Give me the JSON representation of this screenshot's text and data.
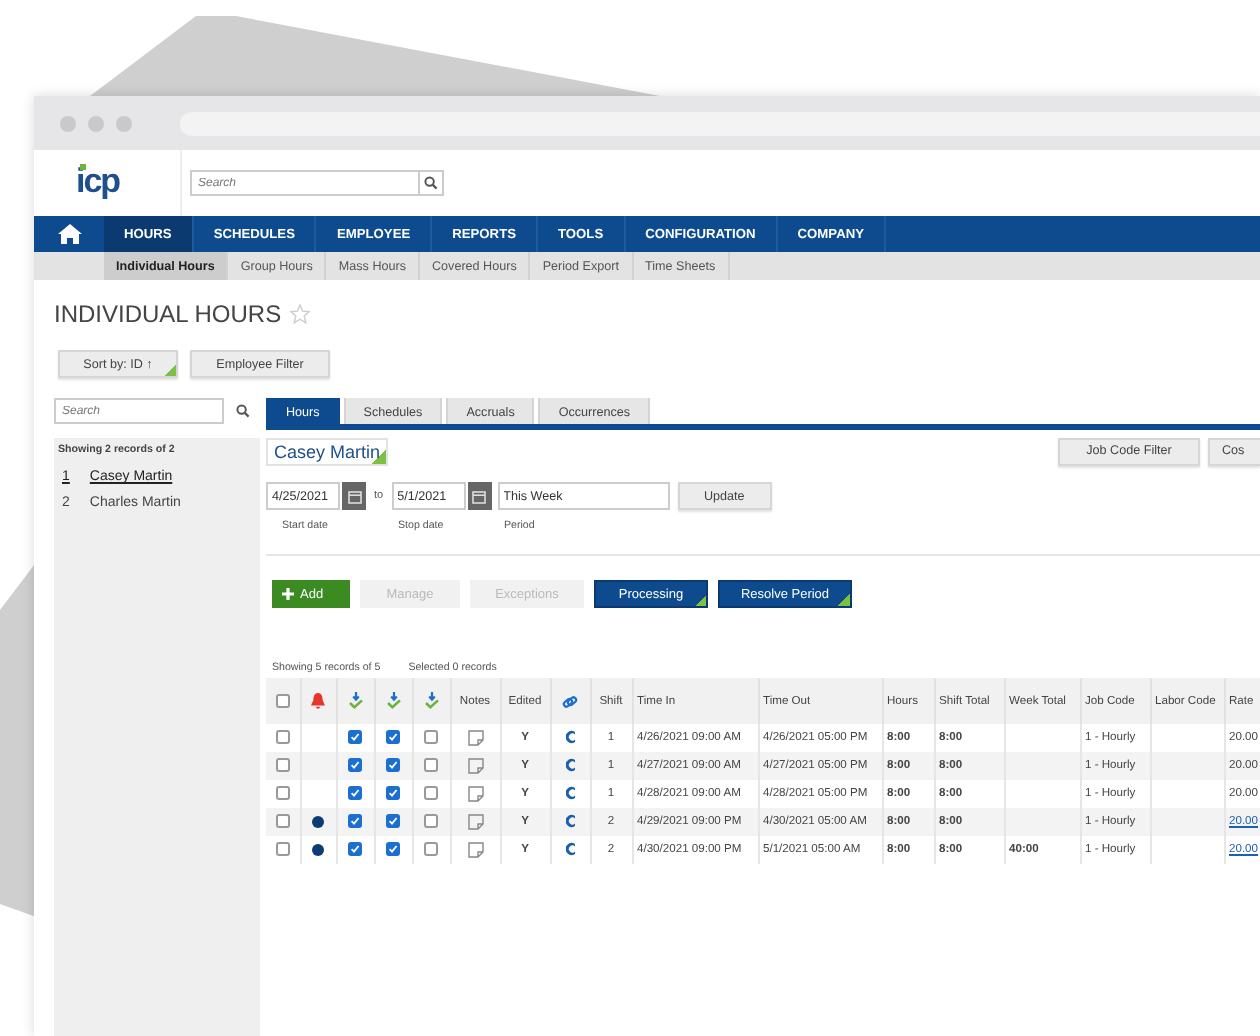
{
  "header": {
    "logo": "icp",
    "search": {
      "placeholder": "Search"
    }
  },
  "nav": [
    {
      "label": "HOURS",
      "selected": true
    },
    {
      "label": "SCHEDULES",
      "selected": false
    },
    {
      "label": "EMPLOYEE",
      "selected": false
    },
    {
      "label": "REPORTS",
      "selected": false
    },
    {
      "label": "TOOLS",
      "selected": false
    },
    {
      "label": "CONFIGURATION",
      "selected": false
    },
    {
      "label": "COMPANY",
      "selected": false
    }
  ],
  "subnav": [
    {
      "label": "Individual Hours",
      "selected": true
    },
    {
      "label": "Group Hours",
      "selected": false
    },
    {
      "label": "Mass Hours",
      "selected": false
    },
    {
      "label": "Covered Hours",
      "selected": false
    },
    {
      "label": "Period Export",
      "selected": false
    },
    {
      "label": "Time Sheets",
      "selected": false
    }
  ],
  "page": {
    "title": "INDIVIDUAL HOURS",
    "sort_button": "Sort by: ID ↑",
    "filter_button": "Employee Filter"
  },
  "employees_panel": {
    "search": {
      "placeholder": "Search"
    },
    "summary": "Showing 2 records of 2",
    "items": [
      {
        "number": "1",
        "name": "Casey Martin",
        "selected": true
      },
      {
        "number": "2",
        "name": "Charles Martin",
        "selected": false
      }
    ]
  },
  "tabs": [
    {
      "label": "Hours",
      "selected": true
    },
    {
      "label": "Schedules",
      "selected": false
    },
    {
      "label": "Accruals",
      "selected": false
    },
    {
      "label": "Occurrences",
      "selected": false
    }
  ],
  "employee_name": "Casey Martin",
  "right_buttons": [
    "Job Code Filter",
    "Cos"
  ],
  "date_range": {
    "start": "4/25/2021",
    "separator": "to",
    "stop": "5/1/2021",
    "period": "This Week",
    "update_button": "Update",
    "labels": [
      "Start date",
      "Stop date",
      "Period"
    ]
  },
  "actions": [
    {
      "label": "Add",
      "kind": "add",
      "disabled": false
    },
    {
      "label": "Manage",
      "kind": "plain",
      "disabled": true
    },
    {
      "label": "Exceptions",
      "kind": "plain",
      "disabled": true
    },
    {
      "label": "Processing",
      "kind": "primary",
      "disabled": false
    },
    {
      "label": "Resolve Period",
      "kind": "primary",
      "disabled": false
    }
  ],
  "table": {
    "summary": "Showing 5 records of 5",
    "selection": "Selected 0 records",
    "all_checked": false,
    "columns": [
      {
        "kind": "checkbox"
      },
      {
        "kind": "bell"
      },
      {
        "kind": "arrow-check"
      },
      {
        "kind": "arrow-check"
      },
      {
        "kind": "arrow-check"
      },
      {
        "kind": "text",
        "label": "Notes"
      },
      {
        "kind": "text",
        "label": "Edited"
      },
      {
        "kind": "link"
      },
      {
        "kind": "text",
        "label": "Shift"
      },
      {
        "kind": "text",
        "label": "Time In"
      },
      {
        "kind": "text",
        "label": "Time Out"
      },
      {
        "kind": "text",
        "label": "Hours"
      },
      {
        "kind": "text",
        "label": "Shift Total"
      },
      {
        "kind": "text",
        "label": "Week Total"
      },
      {
        "kind": "text",
        "label": "Job Code"
      },
      {
        "kind": "text",
        "label": "Labor Code"
      },
      {
        "kind": "text",
        "label": "Rate"
      }
    ],
    "rows": [
      {
        "selected": false,
        "alert": false,
        "checks": [
          true,
          true,
          false
        ],
        "edited": "Y",
        "shift": "1",
        "time_in": "4/26/2021 09:00 AM",
        "time_out": "4/26/2021 05:00 PM",
        "hours": "8:00",
        "shift_total": "8:00",
        "job_code": "1 - Hourly",
        "rate": "20.00",
        "rate_link": false
      },
      {
        "selected": false,
        "alert": false,
        "checks": [
          true,
          true,
          false
        ],
        "edited": "Y",
        "shift": "1",
        "time_in": "4/27/2021 09:00 AM",
        "time_out": "4/27/2021 05:00 PM",
        "hours": "8:00",
        "shift_total": "8:00",
        "job_code": "1 - Hourly",
        "rate": "20.00",
        "rate_link": false
      },
      {
        "selected": false,
        "alert": false,
        "checks": [
          true,
          true,
          false
        ],
        "edited": "Y",
        "shift": "1",
        "time_in": "4/28/2021 09:00 AM",
        "time_out": "4/28/2021 05:00 PM",
        "hours": "8:00",
        "shift_total": "8:00",
        "job_code": "1 - Hourly",
        "rate": "20.00",
        "rate_link": false
      },
      {
        "selected": false,
        "alert": true,
        "checks": [
          true,
          true,
          false
        ],
        "edited": "Y",
        "shift": "2",
        "time_in": "4/29/2021 09:00 PM",
        "time_out": "4/30/2021 05:00 AM",
        "hours": "8:00",
        "shift_total": "8:00",
        "job_code": "1 - Hourly",
        "rate": "20.00",
        "rate_link": true
      },
      {
        "selected": false,
        "alert": true,
        "checks": [
          true,
          true,
          false
        ],
        "edited": "Y",
        "shift": "2",
        "time_in": "4/30/2021 09:00 PM",
        "time_out": "5/1/2021 05:00 AM",
        "hours": "8:00",
        "shift_total": "8:00",
        "week_total": "40:00",
        "job_code": "1 - Hourly",
        "rate": "20.00",
        "rate_link": true
      }
    ]
  }
}
